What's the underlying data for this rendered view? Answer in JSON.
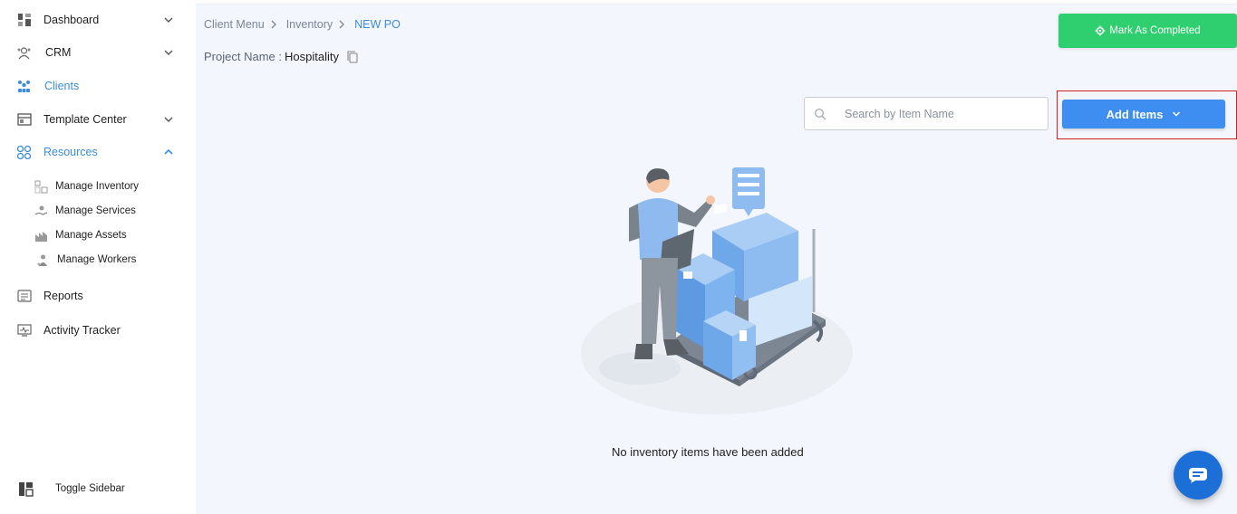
{
  "sidebar": {
    "items": [
      {
        "label": "Dashboard",
        "icon": "dashboard-icon"
      },
      {
        "label": "CRM",
        "icon": "crm-icon"
      },
      {
        "label": "Clients",
        "icon": "clients-icon"
      },
      {
        "label": "Template Center",
        "icon": "template-icon"
      },
      {
        "label": "Resources",
        "icon": "resources-icon"
      },
      {
        "label": "Reports",
        "icon": "reports-icon"
      },
      {
        "label": "Activity Tracker",
        "icon": "activity-icon"
      }
    ],
    "sub_items": [
      {
        "label": "Manage Inventory",
        "icon": "inventory-icon"
      },
      {
        "label": "Manage Services",
        "icon": "services-icon"
      },
      {
        "label": "Manage Assets",
        "icon": "assets-icon"
      },
      {
        "label": "Manage Workers",
        "icon": "workers-icon"
      }
    ],
    "toggle_label": "Toggle Sidebar"
  },
  "breadcrumb": {
    "items": [
      "Client Menu",
      "Inventory",
      "NEW PO"
    ]
  },
  "project": {
    "label": "Project Name :",
    "value": "Hospitality"
  },
  "actions": {
    "complete_label": "Mark As Completed",
    "add_label": "Add Items"
  },
  "search": {
    "placeholder": "Search by Item Name",
    "value": ""
  },
  "empty_state": {
    "message": "No inventory items have been added"
  },
  "colors": {
    "accent": "#3b8de0",
    "success": "#2fcf6f",
    "highlight_border": "#d21f1f",
    "background": "#f3f6fc"
  }
}
